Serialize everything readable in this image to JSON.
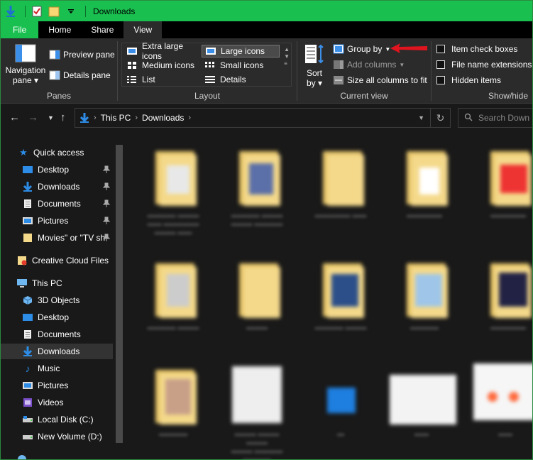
{
  "window": {
    "title": "Downloads"
  },
  "tabs": [
    {
      "label": "File"
    },
    {
      "label": "Home"
    },
    {
      "label": "Share"
    },
    {
      "label": "View"
    }
  ],
  "ribbon": {
    "panes": {
      "navigation_pane": "Navigation\npane",
      "navigation_pane_line1": "Navigation",
      "navigation_pane_line2": "pane",
      "preview_pane": "Preview pane",
      "details_pane": "Details pane",
      "label": "Panes"
    },
    "layout": {
      "items": [
        "Extra large icons",
        "Large icons",
        "Medium icons",
        "Small icons",
        "List",
        "Details"
      ],
      "selected": "Large icons",
      "label": "Layout"
    },
    "current_view": {
      "sort_line1": "Sort",
      "sort_line2": "by",
      "group_by": "Group by",
      "add_columns": "Add columns",
      "size_all": "Size all columns to fit",
      "label": "Current view"
    },
    "show_hide": {
      "item_check_boxes": "Item check boxes",
      "file_name_extensions": "File name extensions",
      "hidden_items": "Hidden items",
      "label": "Show/hide"
    }
  },
  "address": {
    "crumbs": [
      "This PC",
      "Downloads"
    ],
    "search_placeholder": "Search Down"
  },
  "navpane": {
    "quick_access": "Quick access",
    "quick_items": [
      {
        "label": "Desktop",
        "icon": "desktop-icon",
        "pinned": true
      },
      {
        "label": "Downloads",
        "icon": "downloads-icon",
        "pinned": true
      },
      {
        "label": "Documents",
        "icon": "documents-icon",
        "pinned": true
      },
      {
        "label": "Pictures",
        "icon": "pictures-icon",
        "pinned": true
      },
      {
        "label": "Movies\" or \"TV sh",
        "icon": "folder-icon",
        "pinned": true
      }
    ],
    "creative_cloud": "Creative Cloud Files",
    "this_pc": "This PC",
    "pc_items": [
      {
        "label": "3D Objects",
        "icon": "3d-objects-icon"
      },
      {
        "label": "Desktop",
        "icon": "desktop-icon"
      },
      {
        "label": "Documents",
        "icon": "documents-icon"
      },
      {
        "label": "Downloads",
        "icon": "downloads-icon",
        "selected": true
      },
      {
        "label": "Music",
        "icon": "music-icon"
      },
      {
        "label": "Pictures",
        "icon": "pictures-icon"
      },
      {
        "label": "Videos",
        "icon": "videos-icon"
      },
      {
        "label": "Local Disk (C:)",
        "icon": "drive-icon"
      },
      {
        "label": "New Volume (D:)",
        "icon": "drive-icon"
      }
    ]
  },
  "colors": {
    "titlebar": "#19c050",
    "background": "#191919",
    "ribbon": "#2b2b2b",
    "accent_blue": "#2d8ce6",
    "arrow_red": "#e0141e"
  }
}
